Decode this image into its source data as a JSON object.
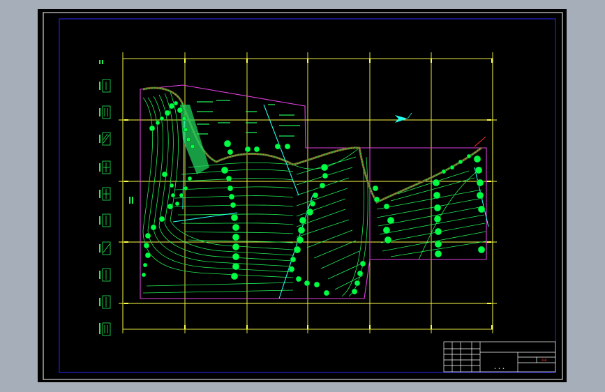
{
  "colors": {
    "background_gray": "#a6aeb9",
    "sheet": "#000000",
    "sheet_border": "#ffffff",
    "drawing_frame": "#2a2aff",
    "grid": "#ffff4a",
    "contour": "#22ee55",
    "boundary": "#e040e0",
    "road": "#22ffee",
    "trees": "#00ff44",
    "accent_red": "#ff3030"
  },
  "drawing": {
    "grid_axis_columns": 6,
    "grid_axis_rows": 4,
    "tree_symbol": "tree-circle-icon",
    "north_arrow_symbol": "north-arrow-icon"
  },
  "title_block": {
    "center_text": "• • •",
    "red_tag": "AAB"
  }
}
